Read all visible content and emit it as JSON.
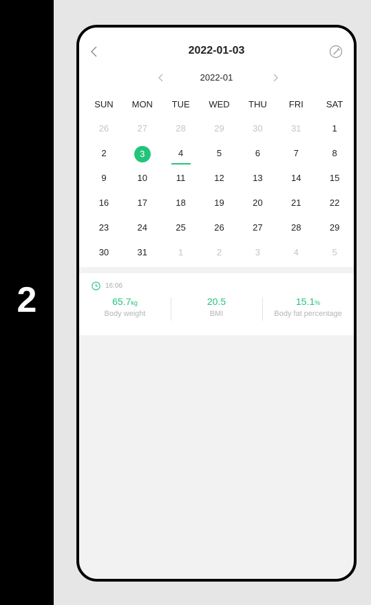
{
  "step": "2",
  "header": {
    "title": "2022-01-03"
  },
  "month_nav": {
    "label": "2022-01"
  },
  "weekdays": [
    "SUN",
    "MON",
    "TUE",
    "WED",
    "THU",
    "FRI",
    "SAT"
  ],
  "weeks": [
    [
      "26",
      "27",
      "28",
      "29",
      "30",
      "31",
      "1"
    ],
    [
      "2",
      "3",
      "4",
      "5",
      "6",
      "7",
      "8"
    ],
    [
      "9",
      "10",
      "11",
      "12",
      "13",
      "14",
      "15"
    ],
    [
      "16",
      "17",
      "18",
      "19",
      "20",
      "21",
      "22"
    ],
    [
      "23",
      "24",
      "25",
      "26",
      "27",
      "28",
      "29"
    ],
    [
      "30",
      "31",
      "1",
      "2",
      "3",
      "4",
      "5"
    ]
  ],
  "accent_color": "#23c47a",
  "record": {
    "time": "16:06",
    "metrics": [
      {
        "value": "65.7",
        "unit": "kg",
        "label": "Body weight"
      },
      {
        "value": "20.5",
        "unit": "",
        "label": "BMI"
      },
      {
        "value": "15.1",
        "unit": "%",
        "label": "Body fat percentage"
      }
    ]
  }
}
